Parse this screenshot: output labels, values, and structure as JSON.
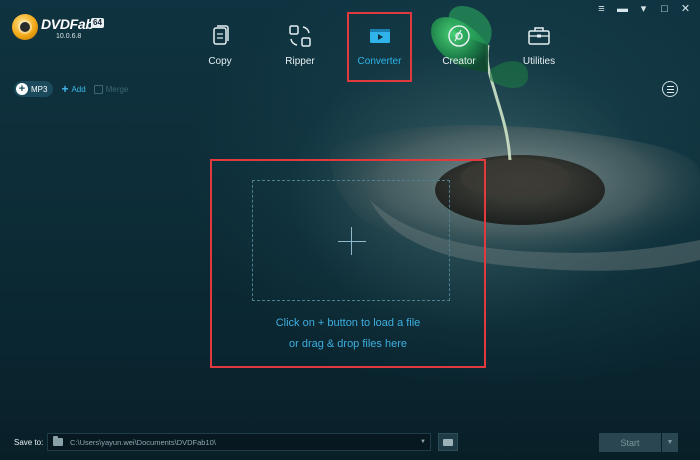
{
  "window_controls": {
    "menu_glyph": "≡",
    "minimize_glyph": "▬",
    "restore_glyph": "▾",
    "maximize_glyph": "□",
    "close_glyph": "✕"
  },
  "logo": {
    "name": "DVDFab",
    "badge": "64",
    "version": "10.0.6.8"
  },
  "nav": {
    "items": [
      {
        "label": "Copy",
        "icon": "copy-icon"
      },
      {
        "label": "Ripper",
        "icon": "ripper-icon"
      },
      {
        "label": "Converter",
        "icon": "converter-icon",
        "active": true
      },
      {
        "label": "Creator",
        "icon": "creator-icon"
      },
      {
        "label": "Utilities",
        "icon": "utilities-icon"
      }
    ]
  },
  "toolbar": {
    "profile_label": "MP3",
    "add_label": "Add",
    "merge_label": "Merge"
  },
  "drop_zone": {
    "hint_line1": "Click on + button to load a file",
    "hint_line2": "or drag & drop files here"
  },
  "bottom": {
    "save_to_label": "Save to:",
    "path": "C:\\Users\\yayun.wei\\Documents\\DVDFab10\\",
    "start_label": "Start"
  },
  "colors": {
    "accent": "#2fb3ea",
    "highlight_border": "#e0393e",
    "background": "#0d2d38"
  }
}
